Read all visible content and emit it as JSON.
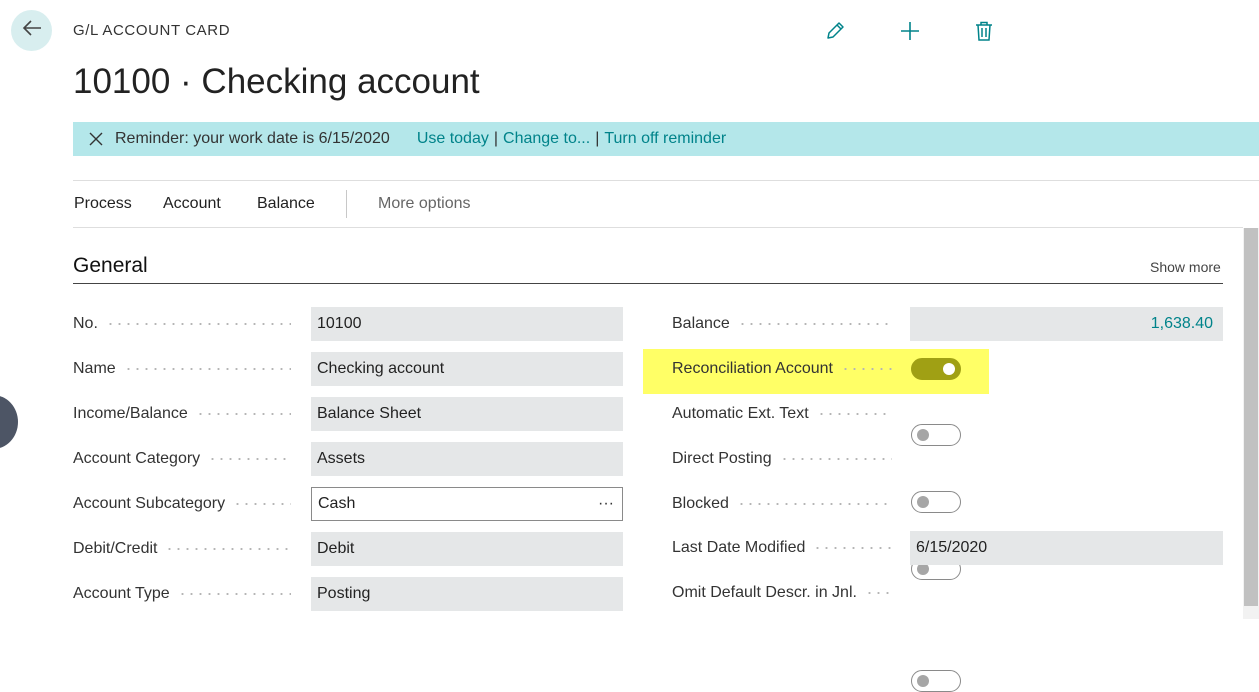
{
  "header": {
    "breadcrumb": "G/L ACCOUNT CARD",
    "title": "10100 · Checking account",
    "icons": [
      "back-arrow-icon",
      "pencil-icon",
      "plus-icon",
      "trash-icon"
    ]
  },
  "banner": {
    "message": "Reminder: your work date is 6/15/2020",
    "use_today": "Use today",
    "change_to": "Change to...",
    "turn_off": "Turn off reminder",
    "separator": "|"
  },
  "menu": {
    "process": "Process",
    "account": "Account",
    "balance": "Balance",
    "more": "More options"
  },
  "section": {
    "title": "General",
    "show_more": "Show more"
  },
  "left_fields": {
    "no": {
      "label": "No.",
      "value": "10100"
    },
    "name": {
      "label": "Name",
      "value": "Checking account"
    },
    "income_balance": {
      "label": "Income/Balance",
      "value": "Balance Sheet"
    },
    "account_category": {
      "label": "Account Category",
      "value": "Assets"
    },
    "account_subcategory": {
      "label": "Account Subcategory",
      "value": "Cash",
      "ellipsis": "···"
    },
    "debit_credit": {
      "label": "Debit/Credit",
      "value": "Debit"
    },
    "account_type": {
      "label": "Account Type",
      "value": "Posting"
    }
  },
  "right_fields": {
    "balance": {
      "label": "Balance",
      "value": "1,638.40"
    },
    "reconciliation": {
      "label": "Reconciliation Account",
      "on": true
    },
    "auto_ext_text": {
      "label": "Automatic Ext. Text",
      "on": false
    },
    "direct_posting": {
      "label": "Direct Posting",
      "on": false
    },
    "blocked": {
      "label": "Blocked",
      "on": false
    },
    "last_modified": {
      "label": "Last Date Modified",
      "value": "6/15/2020"
    },
    "omit_default": {
      "label": "Omit Default Descr. in Jnl.",
      "on": false
    }
  },
  "colors": {
    "accent": "#00838a",
    "banner_bg": "#b4e7ea",
    "toggle_on": "#a0a014",
    "highlight": "#ffff66"
  }
}
